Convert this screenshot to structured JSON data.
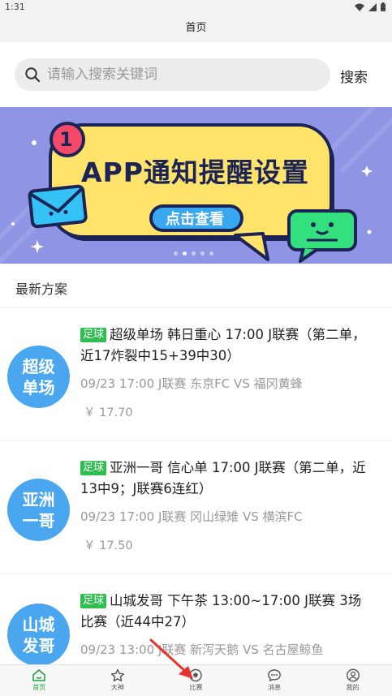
{
  "status_bar": {
    "time": "1:31"
  },
  "header": {
    "title": "首页"
  },
  "search": {
    "placeholder": "请输入搜索关键词",
    "button_label": "搜索"
  },
  "banner": {
    "badge_number": "1",
    "headline": "APP通知提醒设置",
    "cta_label": "点击查看",
    "dots_count": 5,
    "active_dot": 1
  },
  "section": {
    "title": "最新方案"
  },
  "cards": [
    {
      "avatar_line1": "超级",
      "avatar_line2": "单场",
      "tag": "足球",
      "title": "超级单场 韩日重心 17:00 J联赛（第二单，近17炸裂中15+39中30）",
      "meta": "09/23 17:00 J联赛 东京FC VS 福冈黄蜂",
      "price": "￥ 17.70"
    },
    {
      "avatar_line1": "亚洲",
      "avatar_line2": "一哥",
      "tag": "足球",
      "title": "亚洲一哥 信心单 17:00 J联赛（第二单，近13中9；J联赛6连红）",
      "meta": "09/23 17:00 J联赛 冈山绿雉 VS 横滨FC",
      "price": "￥ 17.50"
    },
    {
      "avatar_line1": "山城",
      "avatar_line2": "发哥",
      "tag": "足球",
      "title": "山城发哥 下午茶 13:00~17:00 J联赛 3场比赛（近44中27）",
      "meta": "09/23 13:00 J联赛 新泻天鹅 VS 名古屋鲸鱼",
      "price": ""
    }
  ],
  "bottom_nav": [
    {
      "label": "首页",
      "icon": "home-icon",
      "active": true
    },
    {
      "label": "大神",
      "icon": "star-icon",
      "active": false
    },
    {
      "label": "比赛",
      "icon": "football-icon",
      "active": false
    },
    {
      "label": "消息",
      "icon": "message-icon",
      "active": false
    },
    {
      "label": "我的",
      "icon": "user-icon",
      "active": false
    }
  ],
  "colors": {
    "accent": "#1fa33f",
    "tag_green": "#2fbf4f",
    "avatar_blue": "#4aa6ee",
    "banner_bg": "#8f94e4",
    "annotation_arrow": "#e8332c"
  }
}
